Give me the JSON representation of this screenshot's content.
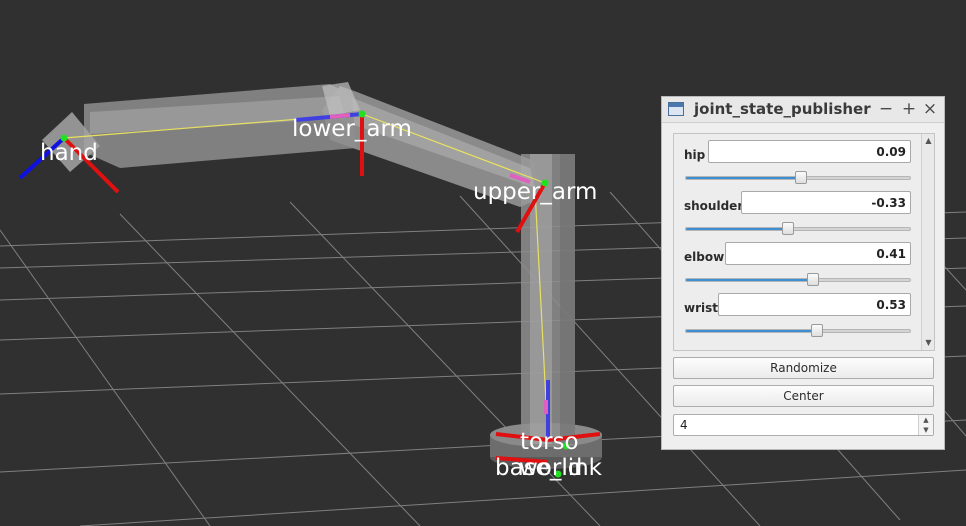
{
  "viewport": {
    "frame_labels": {
      "hand": "hand",
      "lower_arm": "lower_arm",
      "upper_arm": "upper_arm",
      "torso": "torso",
      "base_link": "base_link",
      "world": "world"
    },
    "colors": {
      "background": "#303030",
      "grid": "#a0a0a0",
      "link_body": "#bdbdbd",
      "x_axis": "#e01010",
      "y_axis": "#10d010",
      "z_axis": "#1010e0",
      "tf_line": "#e8e060"
    }
  },
  "window": {
    "title": "joint_state_publisher",
    "icon": "app-window-icon",
    "controls": {
      "minimize": "−",
      "maximize": "+",
      "close": "×"
    },
    "joints": [
      {
        "name": "hip",
        "value": "0.09",
        "slider_fraction": 0.51
      },
      {
        "name": "shoulder",
        "value": "-0.33",
        "slider_fraction": 0.45
      },
      {
        "name": "elbow",
        "value": "0.41",
        "slider_fraction": 0.56
      },
      {
        "name": "wrist",
        "value": "0.53",
        "slider_fraction": 0.58
      }
    ],
    "scroll_up_icon": "▲",
    "scroll_down_icon": "▼",
    "randomize_label": "Randomize",
    "center_label": "Center",
    "spinbox_value": "4",
    "spin_up_icon": "▲",
    "spin_down_icon": "▼",
    "accent_color": "#3d8fd1"
  }
}
